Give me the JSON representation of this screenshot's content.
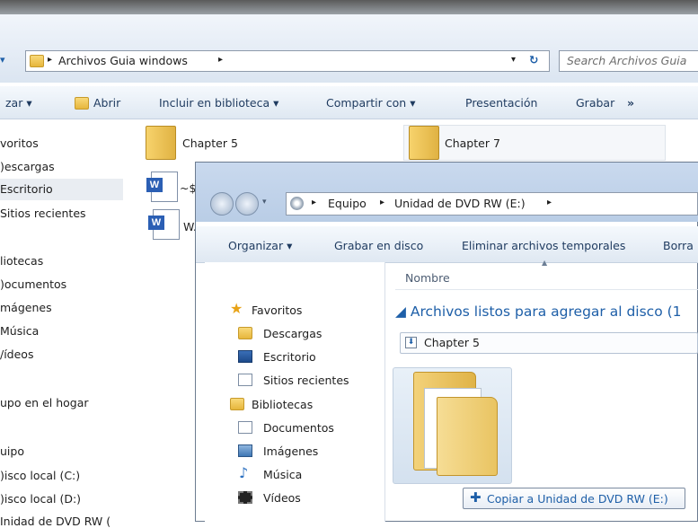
{
  "back_window": {
    "breadcrumb": {
      "sep": "▸",
      "folder": "Archivos Guia windows",
      "after": "▸"
    },
    "search_placeholder": "Search Archivos Guia",
    "toolbar": [
      "zar ▾",
      "Abrir",
      "Incluir en biblioteca ▾",
      "Compartir con ▾",
      "Presentación",
      "Grabar",
      "»"
    ],
    "nav": [
      "voritos",
      ")escargas",
      "Escritorio",
      "Sitios recientes",
      "liotecas",
      ")ocumentos",
      "mágenes",
      "Música",
      "/ídeos",
      "upo en el hogar",
      "uipo",
      ")isco local (C:)",
      ")isco local (D:)",
      "Inidad de DVD RW ("
    ],
    "files": [
      "Chapter 5",
      "Chapter 7",
      "~$",
      "W."
    ]
  },
  "front_window": {
    "breadcrumb": {
      "a": "▸",
      "b": "Equipo",
      "c": "▸",
      "d": "Unidad de DVD RW (E:)",
      "e": "▸"
    },
    "toolbar": [
      "Organizar ▾",
      "Grabar en disco",
      "Eliminar archivos temporales",
      "Borra"
    ],
    "nav": {
      "favorites_title": "Favoritos",
      "favorites": [
        "Descargas",
        "Escritorio",
        "Sitios recientes"
      ],
      "libraries_title": "Bibliotecas",
      "libraries": [
        "Documentos",
        "Imágenes",
        "Música",
        "Vídeos"
      ]
    },
    "column_header": "Nombre",
    "group_header": "◢ Archivos listos para agregar al disco (1",
    "item": "Chapter 5",
    "drag_tooltip": "Copiar a Unidad de DVD RW (E:)"
  },
  "colors": {
    "accent": "#1e5fa8",
    "chrome": "#c9d9ee",
    "selected": "#e9edf2"
  }
}
